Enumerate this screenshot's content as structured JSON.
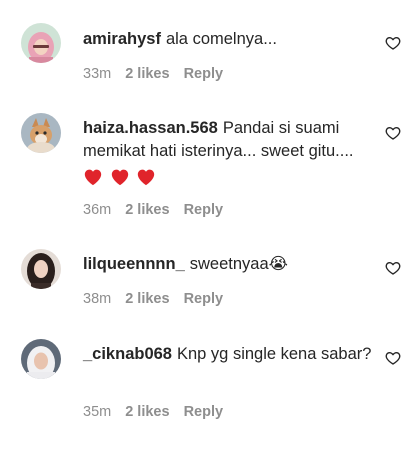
{
  "comments": [
    {
      "username": "amirahysf",
      "text": "ala comelnya...",
      "time": "33m",
      "likes": "2 likes",
      "reply": "Reply",
      "avatar_icon": "avatar-girl-hijab-pink",
      "emoji_hearts": 0
    },
    {
      "username": "haiza.hassan.568",
      "text": "Pandai si suami memikat hati isterinya... sweet gitu....",
      "time": "36m",
      "likes": "2 likes",
      "reply": "Reply",
      "avatar_icon": "avatar-cat",
      "emoji_hearts": 3
    },
    {
      "username": "lilqueennnn_",
      "text": "sweetnyaa😭",
      "time": "38m",
      "likes": "2 likes",
      "reply": "Reply",
      "avatar_icon": "avatar-girl-long-hair",
      "emoji_hearts": 0
    },
    {
      "username": "_ciknab068",
      "text": "Knp yg single kena sabar?",
      "time": "35m",
      "likes": "2 likes",
      "reply": "Reply",
      "avatar_icon": "avatar-girl-hijab-white",
      "emoji_hearts": 0
    }
  ],
  "colors": {
    "text": "#262626",
    "meta": "#8e8e8e",
    "heart_emoji": "#e0242b"
  }
}
